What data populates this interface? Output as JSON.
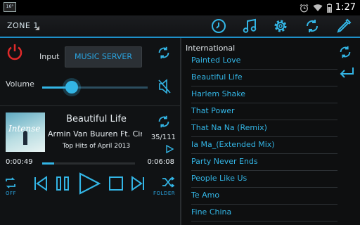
{
  "status_bar": {
    "notification_badge": "16°",
    "time": "1:27",
    "icons": [
      "alarm-icon",
      "wifi-icon",
      "battery-icon"
    ]
  },
  "action_bar": {
    "zone_label": "ZONE 1",
    "icons": [
      "clock-icon",
      "music-note-icon",
      "gear-icon",
      "sync-icon",
      "pen-icon"
    ],
    "accent_color": "#1e90c8"
  },
  "input_section": {
    "input_label": "Input",
    "source_button": "MUSIC SERVER",
    "volume_label": "Volume",
    "volume_level_percent": 28,
    "muted_icon": "speaker-mute-icon"
  },
  "now_playing": {
    "album_art_text": "Intense",
    "title": "Beautiful Life",
    "artist": "Armin Van Buuren Ft. Cindy",
    "album": "Top Hits of April 2013",
    "track_position": "35/111",
    "elapsed": "0:00:49",
    "duration": "0:06:08",
    "progress_percent": 13,
    "repeat_label": "OFF",
    "folder_label": "FOLDER"
  },
  "playlist": {
    "header": "International",
    "items": [
      "Painted Love",
      "Beautiful Life",
      "Harlem Shake",
      "That Power",
      "That Na Na (Remix)",
      "Ia Ma_(Extended Mix)",
      "Party Never Ends",
      "People Like Us",
      "Te Amo",
      "Fine China"
    ]
  }
}
